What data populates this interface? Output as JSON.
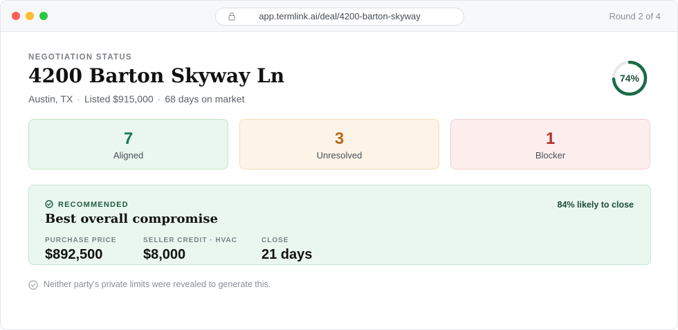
{
  "browser": {
    "url": "app.termlink.ai/deal/4200-barton-skyway",
    "round_label": "Round 2 of 4"
  },
  "header": {
    "eyebrow": "NEGOTIATION STATUS",
    "title": "4200 Barton Skyway Ln",
    "meta": [
      "Austin, TX",
      "Listed $915,000",
      "68 days on market"
    ],
    "progress_label": "74%",
    "progress_value": 0.74
  },
  "stats": [
    {
      "value": "7",
      "label": "Aligned"
    },
    {
      "value": "3",
      "label": "Unresolved"
    },
    {
      "value": "1",
      "label": "Blocker"
    }
  ],
  "recommendation": {
    "badge": "RECOMMENDED",
    "likelihood": "84% likely to close",
    "headline": "Best overall compromise",
    "terms": [
      {
        "label": "PURCHASE PRICE",
        "value": "$892,500"
      },
      {
        "label": "SELLER CREDIT · HVAC",
        "value": "$8,000"
      },
      {
        "label": "CLOSE",
        "value": "21 days"
      }
    ]
  },
  "footnote": "Neither party's private limits were revealed to generate this.",
  "icons": {
    "lock": "lock-icon",
    "check": "check-circle-icon"
  },
  "colors": {
    "accent": "#177a4d",
    "progress": "#1a6b45",
    "aligned": "#177a4d",
    "unresolved": "#b86a1b",
    "blocker": "#b3332e"
  }
}
